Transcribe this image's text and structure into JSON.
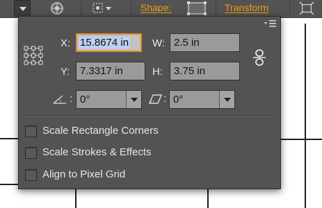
{
  "control_bar": {
    "shape_label": "Shape:",
    "transform_label": "Transform"
  },
  "panel": {
    "x_label": "X:",
    "x_value": "15.8674 in",
    "y_label": "Y:",
    "y_value": "7.3317 in",
    "w_label": "W:",
    "w_value": "2.5 in",
    "h_label": "H:",
    "h_value": "3.75 in",
    "rotate_value": "0°",
    "shear_value": "0°",
    "rotate_colon": ":",
    "shear_colon": ":"
  },
  "options": [
    {
      "label": "Scale Rectangle Corners",
      "checked": false
    },
    {
      "label": "Scale Strokes & Effects",
      "checked": false
    },
    {
      "label": "Align to Pixel Grid",
      "checked": false
    }
  ],
  "colors": {
    "accent": "#f39c12",
    "focus_border": "#e08a1c",
    "panel_bg": "#535353"
  }
}
